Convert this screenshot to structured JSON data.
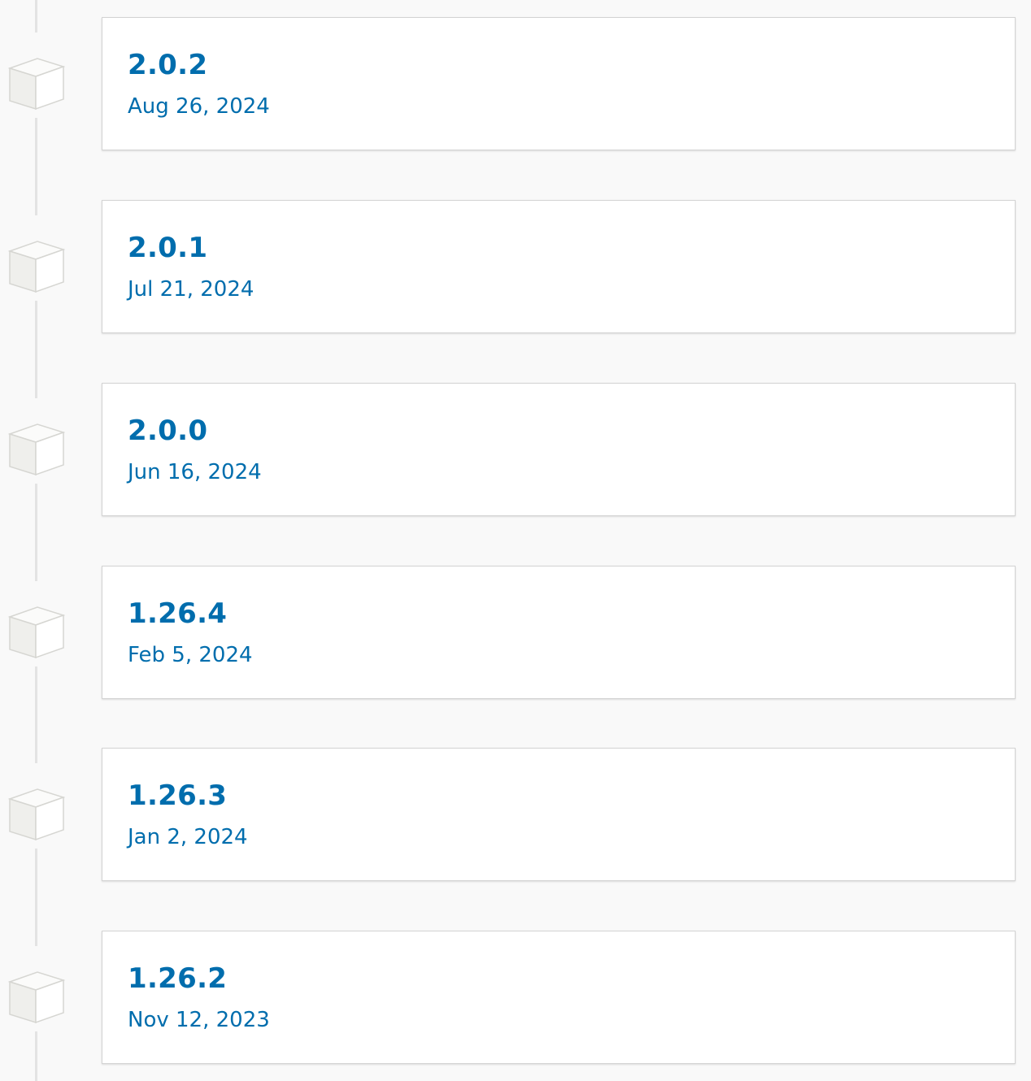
{
  "releases": [
    {
      "version": "2.0.2",
      "date": "Aug 26, 2024"
    },
    {
      "version": "2.0.1",
      "date": "Jul 21, 2024"
    },
    {
      "version": "2.0.0",
      "date": "Jun 16, 2024"
    },
    {
      "version": "1.26.4",
      "date": "Feb 5, 2024"
    },
    {
      "version": "1.26.3",
      "date": "Jan 2, 2024"
    },
    {
      "version": "1.26.2",
      "date": "Nov 12, 2023"
    }
  ],
  "colors": {
    "link": "#006dad",
    "card_border": "#d3d3d3",
    "timeline": "#e3e3e3",
    "background": "#f9f9f9"
  },
  "icons": {
    "release_marker": "package-box-icon"
  }
}
